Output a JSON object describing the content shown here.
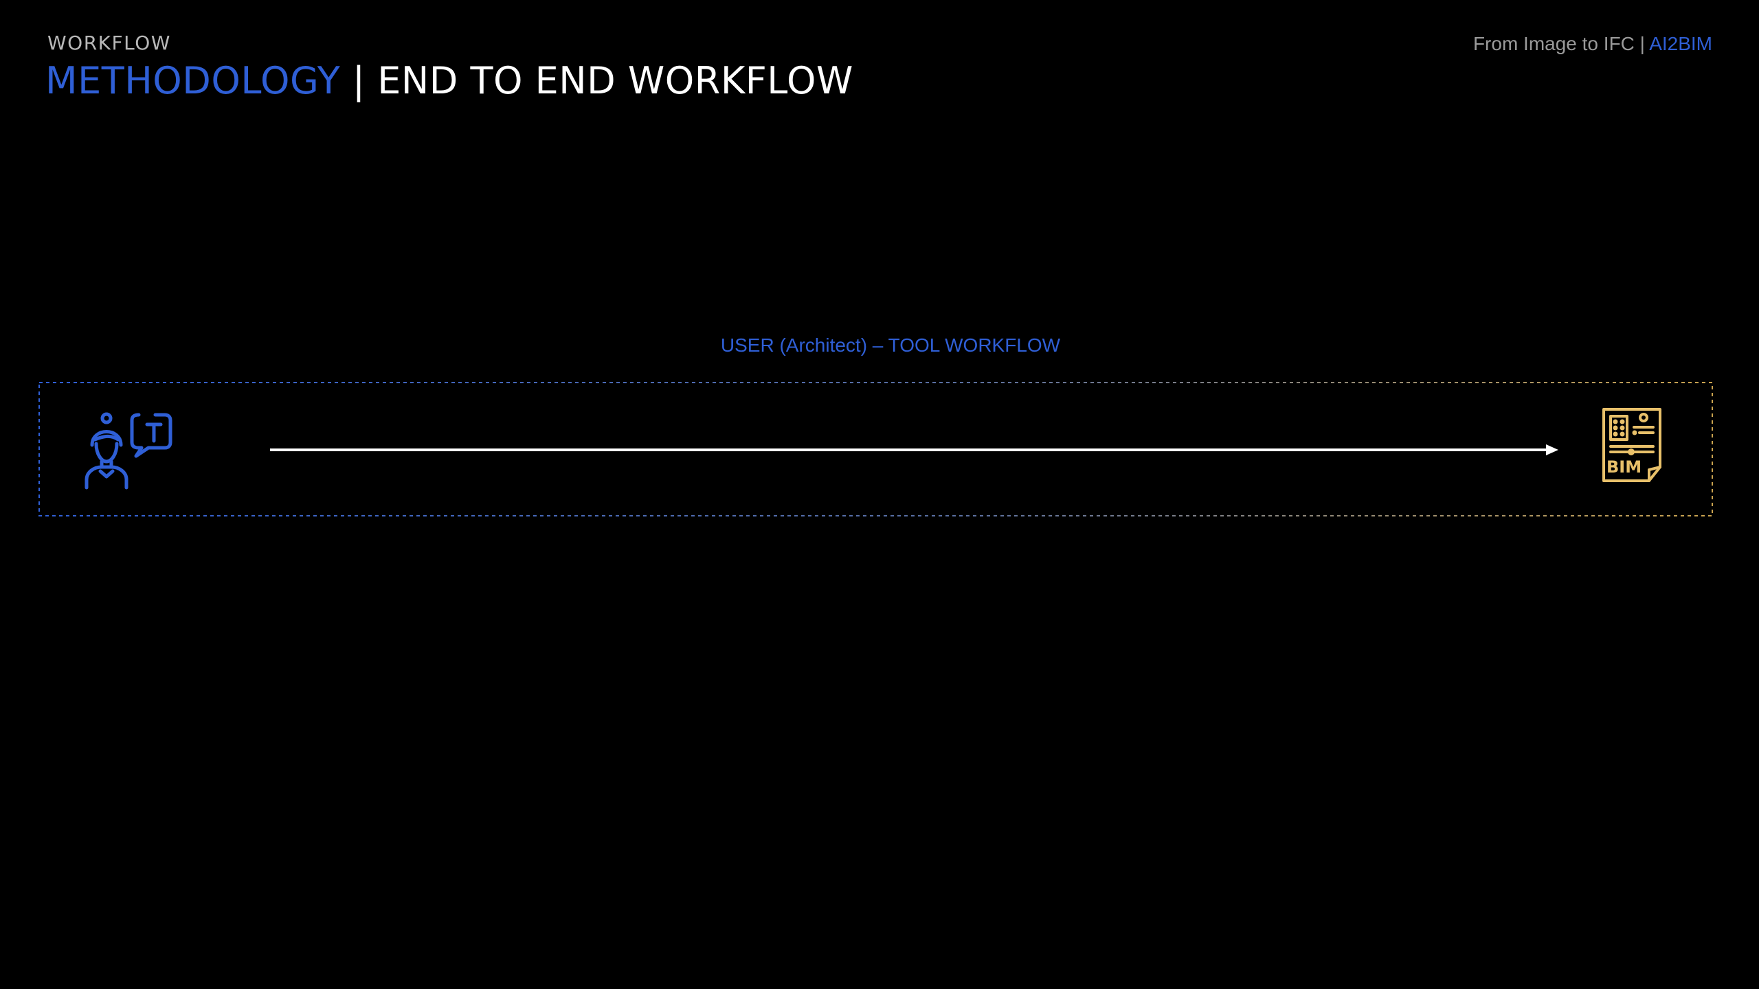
{
  "header": {
    "section_label": "WORKFLOW",
    "title_accent": "METHODOLOGY",
    "title_rest": " | END TO END WORKFLOW",
    "right_text": "From Image to IFC | ",
    "right_brand": "AI2BIM"
  },
  "workflow": {
    "title": "USER (Architect) – TOOL WORKFLOW",
    "start_icon": "architect-speech-icon",
    "end_icon": "bim-document-icon",
    "end_icon_text": "BIM"
  },
  "colors": {
    "background": "#000000",
    "accent_blue": "#2f5fd6",
    "gold": "#e8c06a",
    "white": "#ffffff"
  }
}
